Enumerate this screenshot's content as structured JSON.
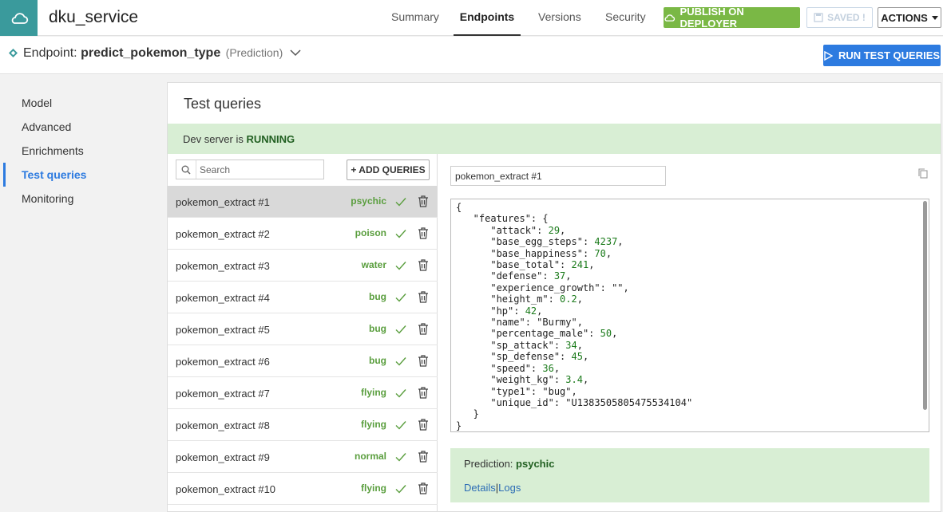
{
  "header": {
    "service_name": "dku_service",
    "tabs": [
      {
        "label": "Summary"
      },
      {
        "label": "Endpoints",
        "active": true
      },
      {
        "label": "Versions"
      },
      {
        "label": "Security"
      }
    ],
    "publish_label": "PUBLISH ON DEPLOYER",
    "saved_label": "SAVED !",
    "actions_label": "ACTIONS",
    "accent_color": "#3a9a9c"
  },
  "subheader": {
    "prefix": "Endpoint:",
    "endpoint_name": "predict_pokemon_type",
    "endpoint_kind": "(Prediction)",
    "run_label": "RUN TEST QUERIES"
  },
  "nav": {
    "items": [
      {
        "label": "Model"
      },
      {
        "label": "Advanced"
      },
      {
        "label": "Enrichments"
      },
      {
        "label": "Test queries",
        "active": true
      },
      {
        "label": "Monitoring"
      }
    ]
  },
  "panel": {
    "title": "Test queries",
    "status_prefix": "Dev server is",
    "status_value": "RUNNING",
    "search_placeholder": "Search",
    "add_label": "+ ADD QUERIES",
    "queries": [
      {
        "name": "pokemon_extract #1",
        "label": "psychic"
      },
      {
        "name": "pokemon_extract #2",
        "label": "poison"
      },
      {
        "name": "pokemon_extract #3",
        "label": "water"
      },
      {
        "name": "pokemon_extract #4",
        "label": "bug"
      },
      {
        "name": "pokemon_extract #5",
        "label": "bug"
      },
      {
        "name": "pokemon_extract #6",
        "label": "bug"
      },
      {
        "name": "pokemon_extract #7",
        "label": "flying"
      },
      {
        "name": "pokemon_extract #8",
        "label": "flying"
      },
      {
        "name": "pokemon_extract #9",
        "label": "normal"
      },
      {
        "name": "pokemon_extract #10",
        "label": "flying"
      }
    ]
  },
  "detail": {
    "query_name": "pokemon_extract #1",
    "json_text": "{\n   \"features\": {\n      \"attack\": 29,\n      \"base_egg_steps\": 4237,\n      \"base_happiness\": 70,\n      \"base_total\": 241,\n      \"defense\": 37,\n      \"experience_growth\": \"\",\n      \"height_m\": 0.2,\n      \"hp\": 42,\n      \"name\": \"Burmy\",\n      \"percentage_male\": 50,\n      \"sp_attack\": 34,\n      \"sp_defense\": 45,\n      \"speed\": 36,\n      \"weight_kg\": 3.4,\n      \"type1\": \"bug\",\n      \"unique_id\": \"U1383505805475534104\"\n   }\n}",
    "prediction_prefix": "Prediction:",
    "prediction_value": "psychic",
    "details_link": "Details",
    "separator": "|",
    "logs_link": "Logs"
  }
}
